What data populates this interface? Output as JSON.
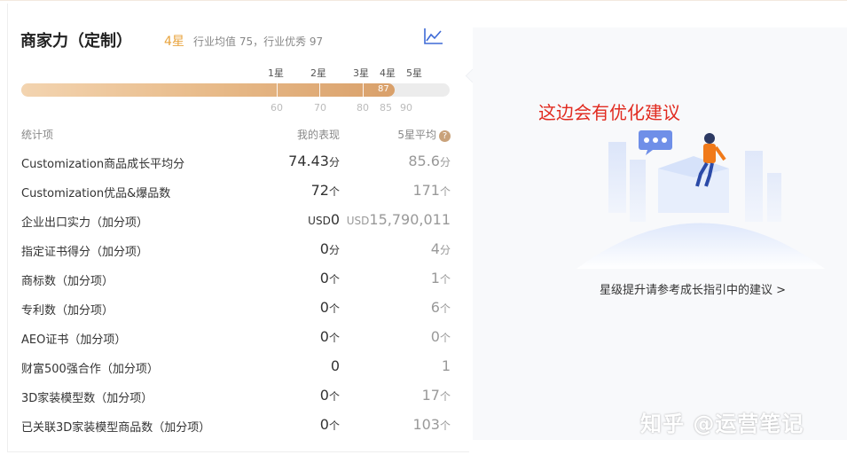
{
  "card": {
    "title": "商家力（定制）",
    "current_star": "4星",
    "industry_text": "行业均值 75，行业优秀 97",
    "score": "87",
    "score_fraction": 0.87,
    "star_labels": [
      "1星",
      "2星",
      "3星",
      "4星",
      "5星"
    ],
    "tick_labels": [
      "60",
      "70",
      "80",
      "85",
      "90"
    ]
  },
  "table": {
    "headers": {
      "item": "统计项",
      "mine": "我的表现",
      "avg": "5星平均"
    },
    "rows": [
      {
        "label": "Customization商品成长平均分",
        "mine_prefix": "",
        "mine": "74.43",
        "mine_unit": "分",
        "avg_prefix": "",
        "avg": "85.6",
        "avg_unit": "分"
      },
      {
        "label": "Customization优品&爆品数",
        "mine_prefix": "",
        "mine": "72",
        "mine_unit": "个",
        "avg_prefix": "",
        "avg": "171",
        "avg_unit": "个"
      },
      {
        "label": "企业出口实力（加分项）",
        "mine_prefix": "USD",
        "mine": "0",
        "mine_unit": "",
        "avg_prefix": "USD",
        "avg": "15,790,011",
        "avg_unit": ""
      },
      {
        "label": "指定证书得分（加分项）",
        "mine_prefix": "",
        "mine": "0",
        "mine_unit": "分",
        "avg_prefix": "",
        "avg": "4",
        "avg_unit": "分"
      },
      {
        "label": "商标数（加分项）",
        "mine_prefix": "",
        "mine": "0",
        "mine_unit": "个",
        "avg_prefix": "",
        "avg": "1",
        "avg_unit": "个"
      },
      {
        "label": "专利数（加分项）",
        "mine_prefix": "",
        "mine": "0",
        "mine_unit": "个",
        "avg_prefix": "",
        "avg": "6",
        "avg_unit": "个"
      },
      {
        "label": "AEO证书（加分项）",
        "mine_prefix": "",
        "mine": "0",
        "mine_unit": "个",
        "avg_prefix": "",
        "avg": "0",
        "avg_unit": "个"
      },
      {
        "label": "财富500强合作（加分项）",
        "mine_prefix": "",
        "mine": "0",
        "mine_unit": "",
        "avg_prefix": "",
        "avg": "1",
        "avg_unit": ""
      },
      {
        "label": "3D家装模型数（加分项）",
        "mine_prefix": "",
        "mine": "0",
        "mine_unit": "个",
        "avg_prefix": "",
        "avg": "17",
        "avg_unit": "个"
      },
      {
        "label": "已关联3D家装模型商品数（加分项）",
        "mine_prefix": "",
        "mine": "0",
        "mine_unit": "个",
        "avg_prefix": "",
        "avg": "103",
        "avg_unit": "个"
      }
    ]
  },
  "right": {
    "suggestion": "这边会有优化建议",
    "guide_link": "星级提升请参考成长指引中的建议 >"
  },
  "watermark": "知乎 @运营笔记",
  "colors": {
    "accent_gold": "#e8a33c",
    "suggestion_red": "#e12b20",
    "bar_fill": "#d9a06a"
  }
}
